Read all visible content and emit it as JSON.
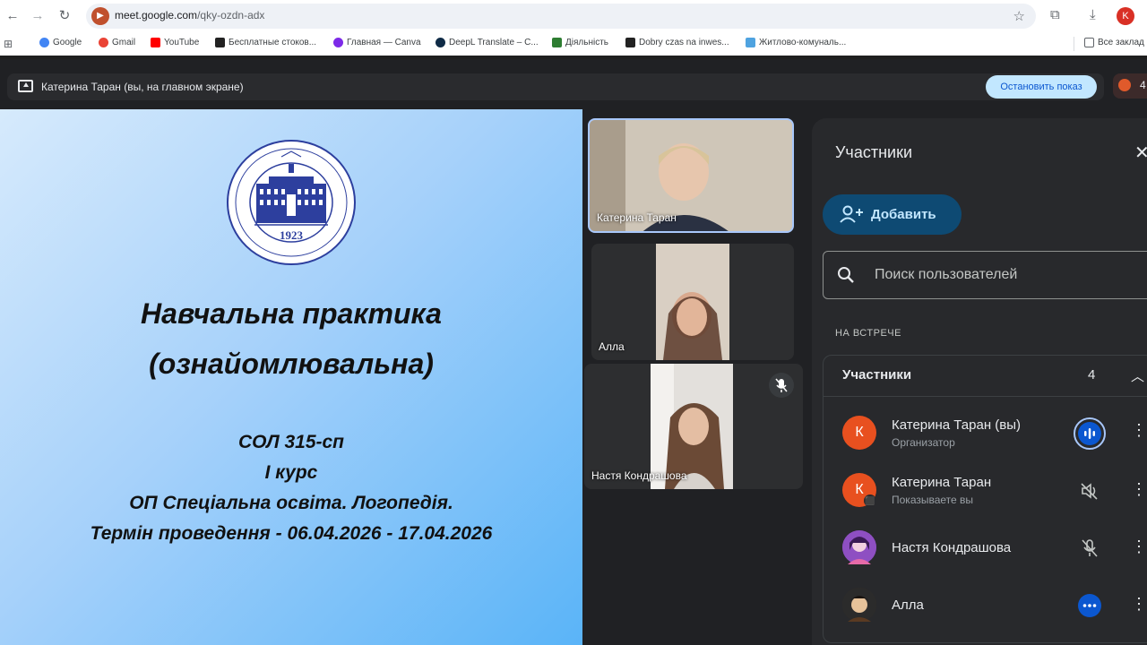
{
  "browser": {
    "url_host": "meet.google.com",
    "url_path": "/qky-ozdn-adx",
    "profile_initial": "K",
    "bookmarks": [
      {
        "label": "Google",
        "color": "#4285f4"
      },
      {
        "label": "Gmail",
        "color": "#ea4335"
      },
      {
        "label": "YouTube",
        "color": "#ff0000"
      },
      {
        "label": "Бесплатные стоков...",
        "color": "#222222"
      },
      {
        "label": "Главная — Canva",
        "color": "#7d2ae8"
      },
      {
        "label": "DeepL Translate – С...",
        "color": "#0f2b46"
      },
      {
        "label": "Діяльність",
        "color": "#2e7d32"
      },
      {
        "label": "Dobry czas na inwes...",
        "color": "#222222"
      },
      {
        "label": "Житлово-комуналь...",
        "color": "#4fa3e0"
      }
    ],
    "all_bookmarks_label": "Все заклад"
  },
  "meet": {
    "presenting_label": "Катерина Таран (вы, на главном экране)",
    "stop_sharing_label": "Остановить показ",
    "corner_count": "4"
  },
  "slide": {
    "logo_year": "1923",
    "title_line1": "Навчальна практика",
    "title_line2": "(ознайомлювальна)",
    "line1": "СОЛ 315-сп",
    "line2": "І курс",
    "line3": "ОП Спеціальна освіта. Логопедія.",
    "line4": "Термін проведення -  06.04.2026 - 17.04.2026"
  },
  "tiles": [
    {
      "name": "Катерина Таран"
    },
    {
      "name": "Алла"
    },
    {
      "name": "Настя Кондрашова"
    }
  ],
  "panel": {
    "title": "Участники",
    "add_label": "Добавить",
    "search_placeholder": "Поиск пользователей",
    "section_label": "НА ВСТРЕЧЕ",
    "group_title": "Участники",
    "group_count": "4",
    "participants": [
      {
        "name": "Катерина Таран (вы)",
        "sub": "Организатор",
        "initial": "К",
        "color": "#e8501f"
      },
      {
        "name": "Катерина Таран",
        "sub": "Показываете вы",
        "initial": "К",
        "color": "#e8501f"
      },
      {
        "name": "Настя Кондрашова",
        "sub": "",
        "initial": "",
        "color": "#7b3fa8"
      },
      {
        "name": "Алла",
        "sub": "",
        "initial": "",
        "color": "#3b2e25"
      }
    ]
  },
  "colors": {
    "accent_blue": "#c2e7ff",
    "panel_bg": "#28292c",
    "avatar_orange": "#e8501f"
  }
}
